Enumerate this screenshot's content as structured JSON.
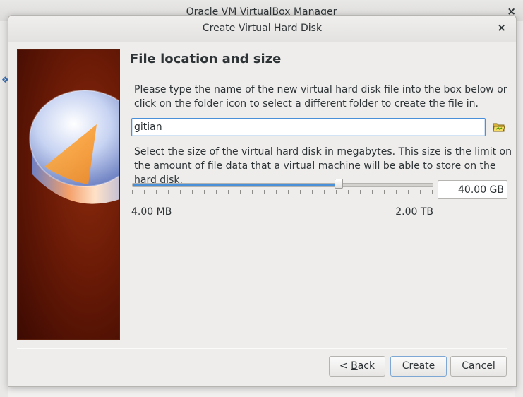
{
  "main_window": {
    "title": "Oracle VM VirtualBox Manager",
    "close_glyph": "×"
  },
  "dialog": {
    "title": "Create Virtual Hard Disk",
    "close_glyph": "×",
    "heading": "File location and size",
    "location_text": "Please type the name of the new virtual hard disk file into the box below or click on the folder icon to select a different folder to create the file in.",
    "file_name": "gitian",
    "folder_icon": "folder-icon",
    "size_text": "Select the size of the virtual hard disk in megabytes. This size is the limit on the amount of file data that a virtual machine will be able to store on the hard disk.",
    "size_value": "40.00 GB",
    "slider_fraction": 0.69,
    "slider_min_label": "4.00 MB",
    "slider_max_label": "2.00 TB",
    "buttons": {
      "back_prefix": "< ",
      "back_mnemonic": "B",
      "back_rest": "ack",
      "create": "Create",
      "cancel": "Cancel"
    }
  },
  "colors": {
    "accent": "#4a90d9",
    "banner": "#6a1a06"
  }
}
